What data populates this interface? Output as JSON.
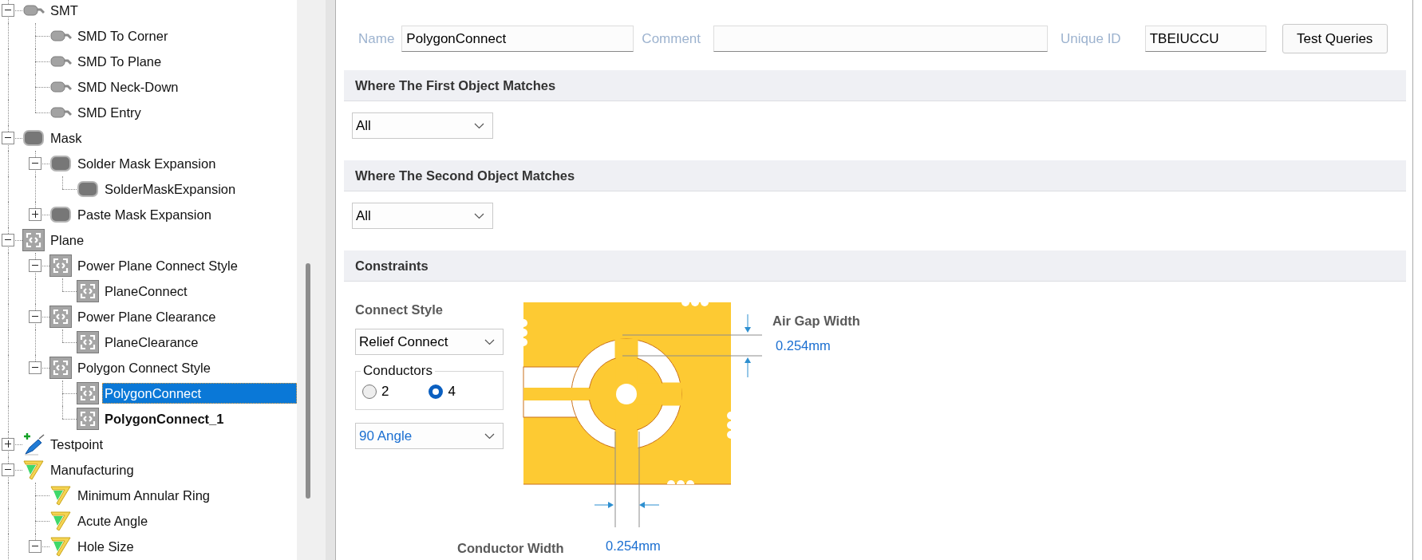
{
  "tree": [
    {
      "label": "SMT",
      "kind": "smt",
      "expanded": true,
      "selected": false,
      "bold": false,
      "children": [
        {
          "label": "SMD To Corner",
          "kind": "smt",
          "selected": false,
          "bold": false
        },
        {
          "label": "SMD To Plane",
          "kind": "smt",
          "selected": false,
          "bold": false
        },
        {
          "label": "SMD Neck-Down",
          "kind": "smt",
          "selected": false,
          "bold": false
        },
        {
          "label": "SMD Entry",
          "kind": "smt",
          "selected": false,
          "bold": false
        }
      ]
    },
    {
      "label": "Mask",
      "kind": "mask",
      "expanded": true,
      "selected": false,
      "bold": false,
      "children": [
        {
          "label": "Solder Mask Expansion",
          "kind": "mask",
          "expanded": true,
          "selected": false,
          "bold": false,
          "children": [
            {
              "label": "SolderMaskExpansion",
              "kind": "mask",
              "selected": false,
              "bold": false
            }
          ]
        },
        {
          "label": "Paste Mask Expansion",
          "kind": "mask",
          "expanded": false,
          "selected": false,
          "bold": false
        }
      ]
    },
    {
      "label": "Plane",
      "kind": "plane",
      "expanded": true,
      "selected": false,
      "bold": false,
      "children": [
        {
          "label": "Power Plane Connect Style",
          "kind": "plane",
          "expanded": true,
          "selected": false,
          "bold": false,
          "children": [
            {
              "label": "PlaneConnect",
              "kind": "plane",
              "selected": false,
              "bold": false
            }
          ]
        },
        {
          "label": "Power Plane Clearance",
          "kind": "plane",
          "expanded": true,
          "selected": false,
          "bold": false,
          "children": [
            {
              "label": "PlaneClearance",
              "kind": "plane",
              "selected": false,
              "bold": false
            }
          ]
        },
        {
          "label": "Polygon Connect Style",
          "kind": "plane",
          "expanded": true,
          "selected": false,
          "bold": false,
          "children": [
            {
              "label": "PolygonConnect",
              "kind": "plane",
              "selected": true,
              "bold": false
            },
            {
              "label": "PolygonConnect_1",
              "kind": "plane",
              "selected": false,
              "bold": true
            }
          ]
        }
      ]
    },
    {
      "label": "Testpoint",
      "kind": "testpoint",
      "expanded": false,
      "selected": false,
      "bold": false
    },
    {
      "label": "Manufacturing",
      "kind": "manufacturing",
      "expanded": true,
      "selected": false,
      "bold": false,
      "children": [
        {
          "label": "Minimum Annular Ring",
          "kind": "manufacturing",
          "selected": false,
          "bold": false
        },
        {
          "label": "Acute Angle",
          "kind": "manufacturing",
          "selected": false,
          "bold": false
        },
        {
          "label": "Hole Size",
          "kind": "manufacturing",
          "expanded": true,
          "selected": false,
          "bold": false
        }
      ]
    }
  ],
  "rule": {
    "name": {
      "label": "Name",
      "value": "PolygonConnect"
    },
    "comment": {
      "label": "Comment"
    },
    "unique_id": {
      "label": "Unique ID",
      "value": "TBEIUCCU"
    },
    "test_button": "Test Queries"
  },
  "sections": [
    {
      "title": "Where The First Object Matches",
      "kind": "query",
      "dropdown": "All"
    },
    {
      "title": "Where The Second Object Matches",
      "kind": "query",
      "dropdown": "All"
    },
    {
      "title": "Constraints",
      "kind": "constraints"
    }
  ],
  "constraints": {
    "connect_style_label": "Connect Style",
    "connect_style": "Relief Connect",
    "conductors": {
      "label": "Conductors",
      "options": [
        {
          "label": "2",
          "selected": false
        },
        {
          "label": "4",
          "selected": true
        }
      ]
    },
    "angle": "90 Angle",
    "air_gap": {
      "label": "Air Gap Width",
      "value": "0.254mm"
    },
    "conductor_width": {
      "label": "Conductor Width",
      "value": "0.254mm"
    }
  }
}
